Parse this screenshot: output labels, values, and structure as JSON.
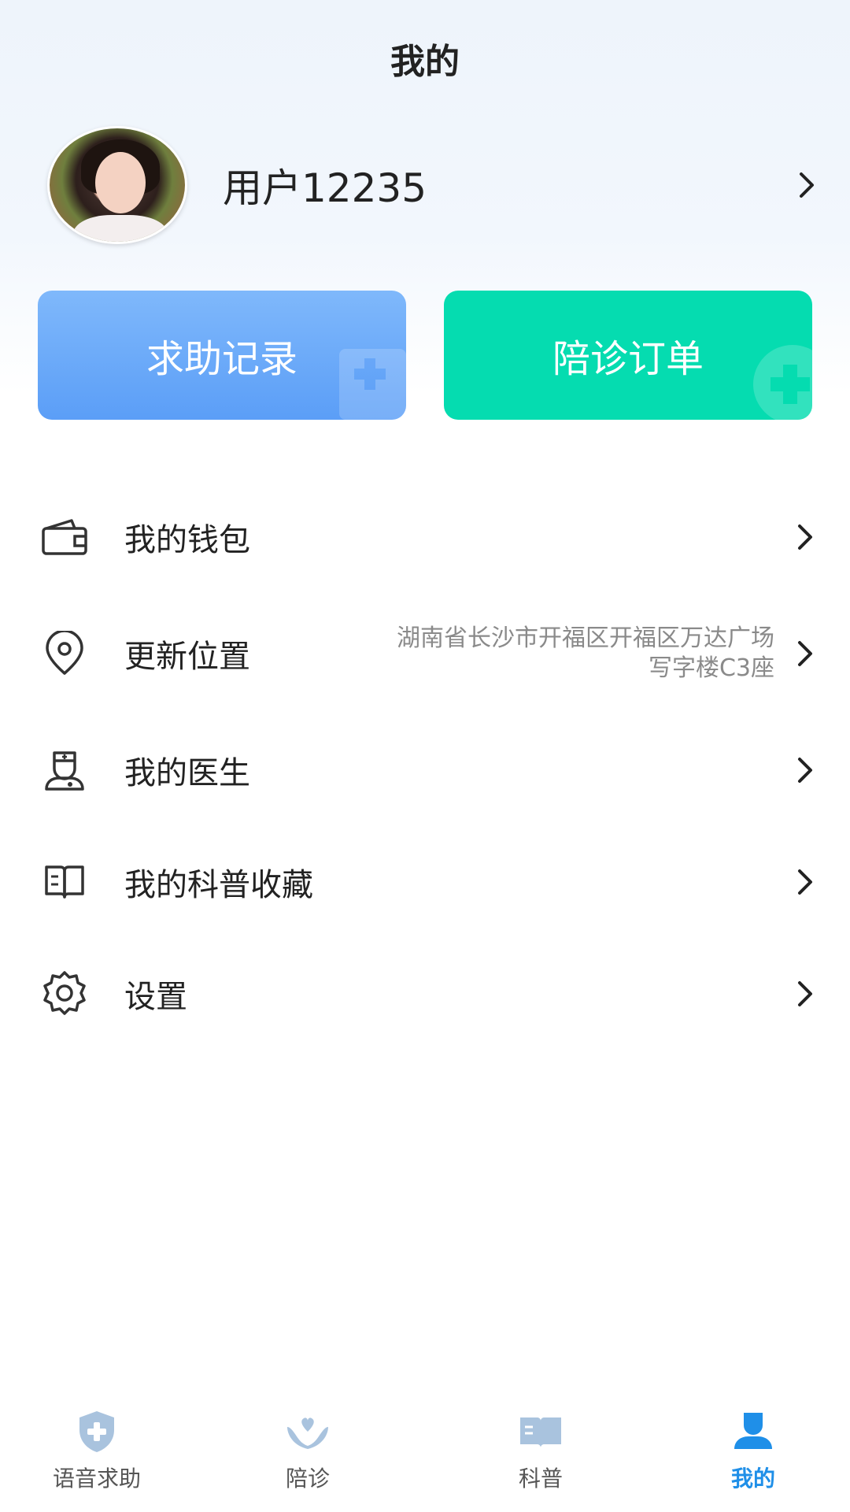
{
  "header": {
    "title": "我的"
  },
  "profile": {
    "username": "用户12235"
  },
  "cards": {
    "help_records": "求助记录",
    "escort_orders": "陪诊订单"
  },
  "menu": {
    "wallet": {
      "label": "我的钱包"
    },
    "location": {
      "label": "更新位置",
      "value_line1": "湖南省长沙市开福区开福区万达广场",
      "value_line2": "写字楼C3座"
    },
    "doctor": {
      "label": "我的医生"
    },
    "favorites": {
      "label": "我的科普收藏"
    },
    "settings": {
      "label": "设置"
    }
  },
  "tabbar": {
    "voice_help": "语音求助",
    "escort": "陪诊",
    "science": "科普",
    "mine": "我的",
    "active": "mine"
  },
  "colors": {
    "accent": "#1f8fe8",
    "card_blue": "#5b9ef7",
    "card_green": "#05dcb0",
    "tab_inactive": "#a9c3de"
  },
  "icons": [
    "wallet-icon",
    "location-pin-icon",
    "doctor-icon",
    "book-icon",
    "gear-icon",
    "chevron-right-icon",
    "shield-plus-icon",
    "hands-heart-icon",
    "book-open-icon",
    "user-icon"
  ]
}
